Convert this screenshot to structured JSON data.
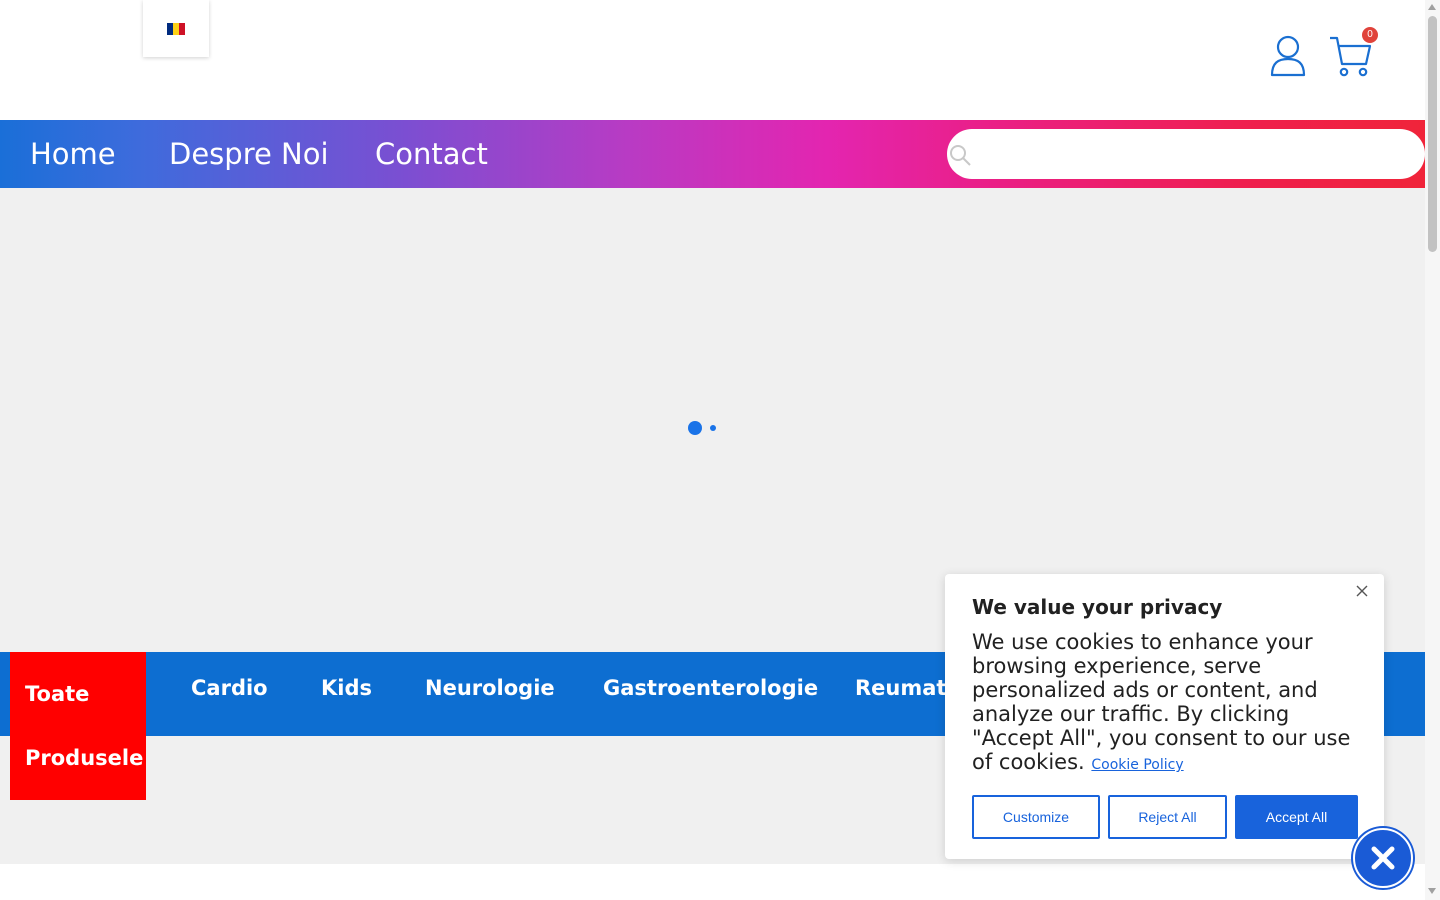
{
  "header": {
    "language_flag": "romania-flag-icon",
    "flag_colors": [
      "#002b7f",
      "#fcd116",
      "#ce1126"
    ],
    "account_icon": "user-icon",
    "cart_icon": "cart-icon",
    "cart_count": "0"
  },
  "nav": {
    "links": [
      "Home",
      "Despre Noi",
      "Contact"
    ],
    "search_placeholder": ""
  },
  "categories": {
    "all_line1": "Toate",
    "all_line2": "Produsele",
    "items": [
      "Cardio",
      "Kids",
      "Neurologie",
      "Gastroenterologie",
      "Reumato"
    ]
  },
  "cookie_banner": {
    "title": "We value your privacy",
    "body": "We use cookies to enhance your browsing experience, serve personalized ads or content, and analyze our traffic. By clicking \"Accept All\", you consent to our use of cookies.",
    "policy_link": "Cookie Policy",
    "customize": "Customize",
    "reject": "Reject All",
    "accept": "Accept All"
  },
  "colors": {
    "accent_blue": "#1863dc",
    "category_bar": "#0d6ed1",
    "all_products_bg": "#ff0000"
  }
}
